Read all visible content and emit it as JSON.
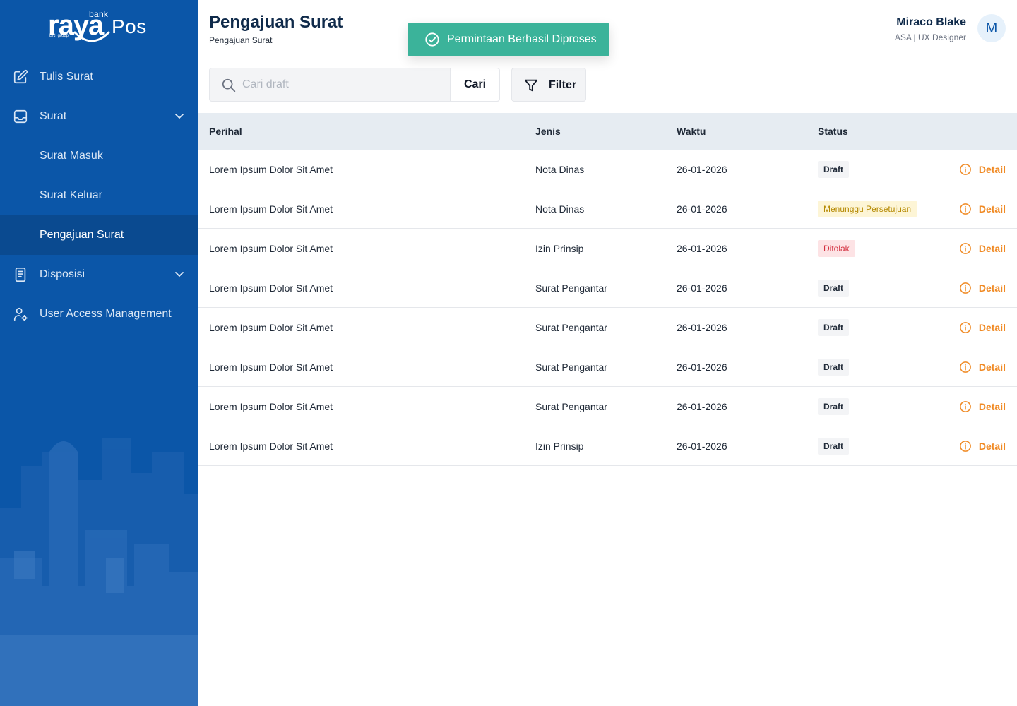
{
  "brand": {
    "bank": "bank",
    "raya": "raya",
    "pos": "Pos",
    "group": "BRI group"
  },
  "toast": {
    "message": "Permintaan Berhasil Diproses",
    "icon": "check-circle-icon",
    "color": "#3bb39a"
  },
  "sidebar": {
    "items": [
      {
        "label": "Tulis Surat",
        "icon": "edit-icon"
      },
      {
        "label": "Surat",
        "icon": "inbox-icon"
      },
      {
        "label": "Surat Masuk"
      },
      {
        "label": "Surat Keluar"
      },
      {
        "label": "Pengajuan Surat"
      },
      {
        "label": "Disposisi",
        "icon": "document-icon"
      },
      {
        "label": "User Access Management",
        "icon": "user-settings-icon"
      }
    ]
  },
  "header": {
    "title": "Pengajuan Surat",
    "breadcrumb": "Pengajuan Surat"
  },
  "user": {
    "name": "Miraco Blake",
    "role": "ASA | UX Designer",
    "initial": "M"
  },
  "search": {
    "placeholder": "Cari draft",
    "button": "Cari"
  },
  "filter": {
    "label": "Filter"
  },
  "table": {
    "headers": {
      "perihal": "Perihal",
      "jenis": "Jenis",
      "waktu": "Waktu",
      "status": "Status"
    },
    "action_label": "Detail",
    "rows": [
      {
        "perihal": "Lorem Ipsum Dolor Sit Amet",
        "jenis": "Nota Dinas",
        "waktu": "26-01-2026",
        "status": "Draft"
      },
      {
        "perihal": "Lorem Ipsum Dolor Sit Amet",
        "jenis": "Nota Dinas",
        "waktu": "26-01-2026",
        "status": "Menunggu Persetujuan"
      },
      {
        "perihal": "Lorem Ipsum Dolor Sit Amet",
        "jenis": "Izin Prinsip",
        "waktu": "26-01-2026",
        "status": "Ditolak"
      },
      {
        "perihal": "Lorem Ipsum Dolor Sit Amet",
        "jenis": "Surat Pengantar",
        "waktu": "26-01-2026",
        "status": "Draft"
      },
      {
        "perihal": "Lorem Ipsum Dolor Sit Amet",
        "jenis": "Surat Pengantar",
        "waktu": "26-01-2026",
        "status": "Draft"
      },
      {
        "perihal": "Lorem Ipsum Dolor Sit Amet",
        "jenis": "Surat Pengantar",
        "waktu": "26-01-2026",
        "status": "Draft"
      },
      {
        "perihal": "Lorem Ipsum Dolor Sit Amet",
        "jenis": "Surat Pengantar",
        "waktu": "26-01-2026",
        "status": "Draft"
      },
      {
        "perihal": "Lorem Ipsum Dolor Sit Amet",
        "jenis": "Izin Prinsip",
        "waktu": "26-01-2026",
        "status": "Draft"
      }
    ]
  },
  "colors": {
    "sidebar": "#0b56a8",
    "active": "#0a4a90",
    "accent": "#f08a24",
    "header_row": "#e6ecf2"
  }
}
